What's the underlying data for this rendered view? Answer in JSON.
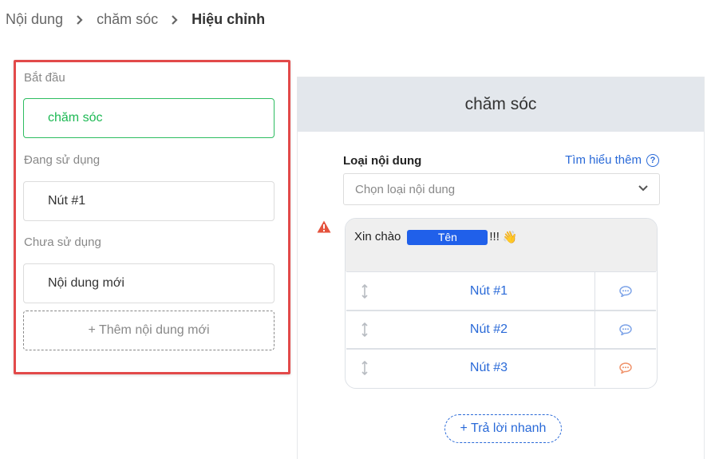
{
  "breadcrumb": {
    "items": [
      "Nội dung",
      "chăm sóc",
      "Hiệu chỉnh"
    ]
  },
  "left": {
    "start_label": "Bắt đầu",
    "start_item": "chăm sóc",
    "in_use_label": "Đang sử dụng",
    "in_use_item": "Nút #1",
    "unused_label": "Chưa sử dụng",
    "unused_item": "Nội dung mới",
    "add_button": "+ Thêm nội dung mới",
    "highlight_color": "#e24a4a",
    "selected_color": "#2dbd60"
  },
  "editor": {
    "title": "chăm sóc",
    "content_type_label": "Loại nội dung",
    "learn_more": "Tìm hiểu thêm",
    "select_placeholder": "Chọn loại nội dung",
    "message": {
      "greeting": "Xin chào",
      "name_tag": "Tên",
      "suffix": "!!!",
      "emoji": "👋"
    },
    "buttons": [
      {
        "label": "Nút #1",
        "icon": "chat-bubble-icon",
        "icon_color": "#7ea4e8"
      },
      {
        "label": "Nút #2",
        "icon": "chat-bubble-icon",
        "icon_color": "#7ea4e8"
      },
      {
        "label": "Nút #3",
        "icon": "chat-bubble-icon",
        "icon_color": "#f0936b"
      }
    ],
    "quick_reply": "+ Trả lời nhanh",
    "accent_color": "#2a6ad8",
    "name_tag_color": "#2060ea",
    "warning_color": "#e5533d"
  }
}
